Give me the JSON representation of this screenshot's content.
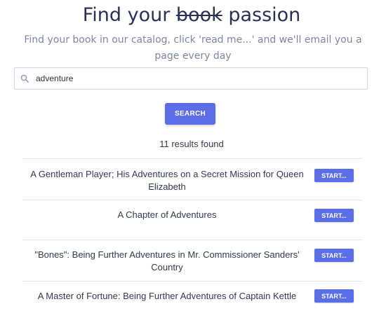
{
  "header": {
    "title_prefix": "Find your",
    "title_strike": "book",
    "title_suffix": "passion",
    "subtitle": "Find your book in our catalog, click 'read me...' and we'll email you a page every day"
  },
  "search": {
    "value": "adventure",
    "icon": "search-icon",
    "button_label": "SEARCH"
  },
  "results": {
    "count_text": "11 results found",
    "items": [
      {
        "title": "A Gentleman Player; His Adventures on a Secret Mission for Queen Elizabeth",
        "button": "START..."
      },
      {
        "title": "A Chapter of Adventures",
        "button": "START..."
      },
      {
        "title": "\"Bones\": Being Further Adventures in Mr. Commissioner Sanders' Country",
        "button": "START..."
      },
      {
        "title": "A Master of Fortune: Being Further Adventures of Captain Kettle",
        "button": "START..."
      }
    ]
  },
  "colors": {
    "accent": "#5b6ee8",
    "title": "#2a3157",
    "subtitle": "#7f879e"
  }
}
